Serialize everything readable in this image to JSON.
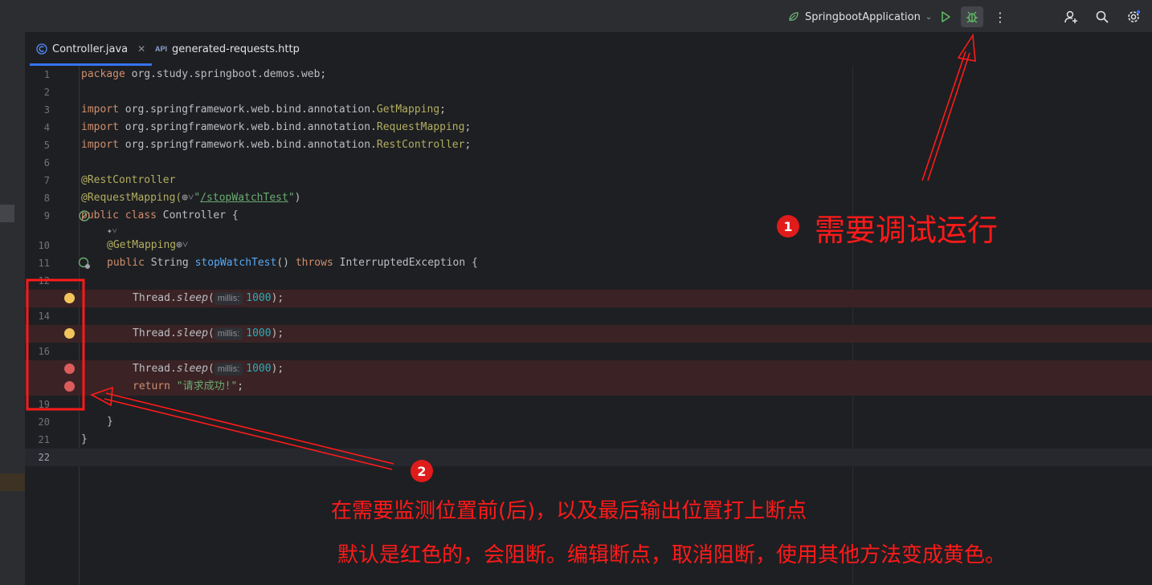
{
  "toolbar": {
    "run_config": "SpringbootApplication",
    "run_icon": "run-icon",
    "debug_icon": "debug-icon",
    "more_icon": "more-icon",
    "add_user_icon": "add-user-icon",
    "search_icon": "search-icon",
    "settings_icon": "settings-icon"
  },
  "tabs": [
    {
      "label": "Controller.java",
      "icon": "java-class-icon",
      "active": true
    },
    {
      "label": "generated-requests.http",
      "icon": "api-icon",
      "active": false
    }
  ],
  "editor": {
    "lines": [
      {
        "n": "1"
      },
      {
        "n": "2"
      },
      {
        "n": "3"
      },
      {
        "n": "4"
      },
      {
        "n": "5"
      },
      {
        "n": "6"
      },
      {
        "n": "7"
      },
      {
        "n": "8"
      },
      {
        "n": "9"
      },
      {
        "n": ""
      },
      {
        "n": "10"
      },
      {
        "n": "11"
      },
      {
        "n": "12"
      },
      {
        "n": "13"
      },
      {
        "n": "14"
      },
      {
        "n": "15"
      },
      {
        "n": "16"
      },
      {
        "n": "17"
      },
      {
        "n": "18"
      },
      {
        "n": "19"
      },
      {
        "n": "20"
      },
      {
        "n": "21"
      },
      {
        "n": "22"
      }
    ],
    "code": {
      "l1": [
        "package",
        " org.study.springboot.demos.web;"
      ],
      "l3": [
        "import",
        " org.springframework.web.bind.annotation.",
        "GetMapping",
        ";"
      ],
      "l4": [
        "import",
        " org.springframework.web.bind.annotation.",
        "RequestMapping",
        ";"
      ],
      "l5": [
        "import",
        " org.springframework.web.bind.annotation.",
        "RestController",
        ";"
      ],
      "l7": [
        "@RestController"
      ],
      "l8": [
        "@RequestMapping(",
        "⊕˅",
        "\"",
        "/stopWatchTest",
        "\"",
        ")"
      ],
      "l9": [
        "public class",
        " Controller {"
      ],
      "l9b": [
        "✦˅"
      ],
      "l10": [
        "@GetMapping",
        "⊕˅"
      ],
      "l11": [
        "public",
        " String ",
        "stopWatchTest",
        "() ",
        "throws",
        " InterruptedException {"
      ],
      "sleep": [
        "Thread.",
        "sleep",
        "(",
        "millis:",
        "1000",
        ");"
      ],
      "l18": [
        "return",
        "\"请求成功!\"",
        ";"
      ],
      "l20": [
        "}"
      ],
      "l21": [
        "}"
      ]
    },
    "breakpoints": [
      {
        "line": "13",
        "color": "yellow"
      },
      {
        "line": "15",
        "color": "yellow"
      },
      {
        "line": "17",
        "color": "red"
      },
      {
        "line": "18",
        "color": "red"
      }
    ]
  },
  "annotations": {
    "badge1": "1",
    "text1": "需要调试运行",
    "badge2": "2",
    "text2a": "在需要监测位置前(后)，以及最后输出位置打上断点",
    "text2b": "默认是红色的，会阻断。编辑断点，取消阻断，使用其他方法变成黄色。",
    "color": "#ff1a1a"
  }
}
